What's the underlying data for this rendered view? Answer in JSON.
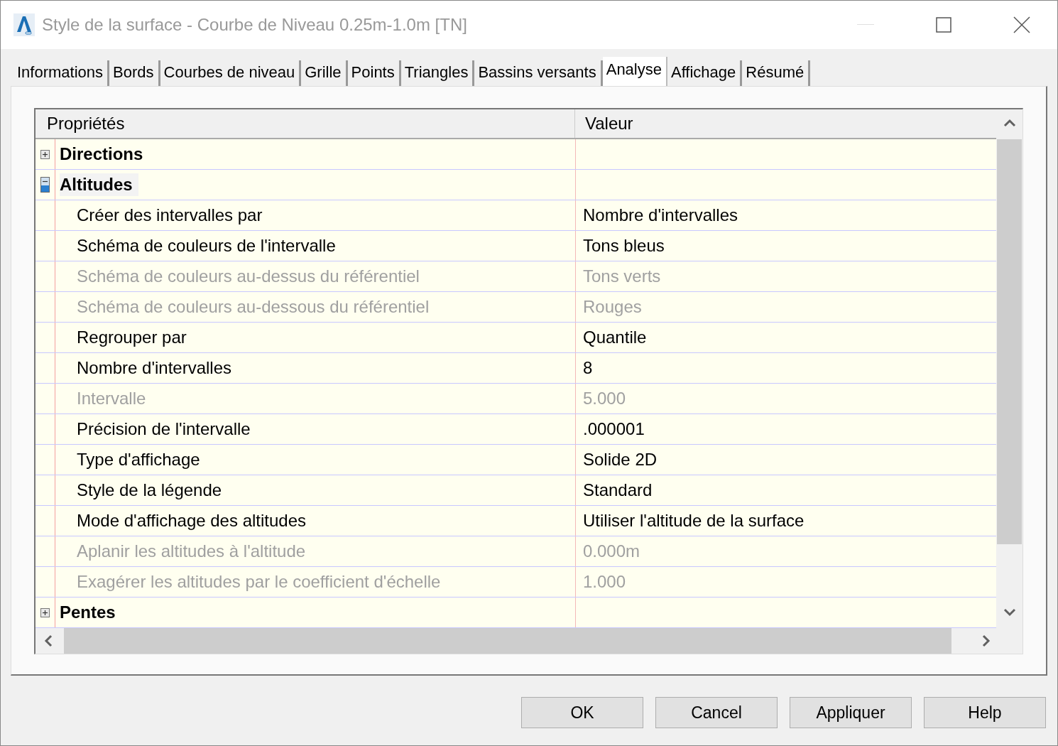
{
  "window": {
    "title": "Style de la surface - Courbe de Niveau 0.25m-1.0m [TN]"
  },
  "tabs": [
    {
      "label": "Informations",
      "selected": false
    },
    {
      "label": "Bords",
      "selected": false
    },
    {
      "label": "Courbes de niveau",
      "selected": false
    },
    {
      "label": "Grille",
      "selected": false
    },
    {
      "label": "Points",
      "selected": false
    },
    {
      "label": "Triangles",
      "selected": false
    },
    {
      "label": "Bassins versants",
      "selected": false
    },
    {
      "label": "Analyse",
      "selected": true
    },
    {
      "label": "Affichage",
      "selected": false
    },
    {
      "label": "Résumé",
      "selected": false
    }
  ],
  "grid": {
    "columns": [
      "Propriétés",
      "Valeur"
    ],
    "categories": [
      {
        "name": "Directions",
        "expanded": false,
        "selected": false
      },
      {
        "name": "Altitudes",
        "expanded": true,
        "selected": true,
        "children": [
          {
            "name": "Créer des intervalles par",
            "value": "Nombre d'intervalles",
            "disabled": false
          },
          {
            "name": "Schéma de couleurs de l'intervalle",
            "value": "Tons bleus",
            "disabled": false
          },
          {
            "name": "Schéma de couleurs au-dessus du référentiel",
            "value": "Tons verts",
            "disabled": true
          },
          {
            "name": "Schéma de couleurs au-dessous du référentiel",
            "value": "Rouges",
            "disabled": true
          },
          {
            "name": "Regrouper par",
            "value": "Quantile",
            "disabled": false
          },
          {
            "name": "Nombre d'intervalles",
            "value": "8",
            "disabled": false
          },
          {
            "name": "Intervalle",
            "value": "5.000",
            "disabled": true
          },
          {
            "name": "Précision de l'intervalle",
            "value": ".000001",
            "disabled": false
          },
          {
            "name": "Type d'affichage",
            "value": "Solide 2D",
            "disabled": false
          },
          {
            "name": "Style de la légende",
            "value": "Standard",
            "disabled": false
          },
          {
            "name": "Mode d'affichage des altitudes",
            "value": "Utiliser l'altitude de la surface",
            "disabled": false
          },
          {
            "name": "Aplanir les altitudes à l'altitude",
            "value": "0.000m",
            "disabled": true
          },
          {
            "name": "Exagérer les altitudes par le coefficient d'échelle",
            "value": "1.000",
            "disabled": true
          }
        ]
      },
      {
        "name": "Pentes",
        "expanded": false,
        "selected": false
      }
    ]
  },
  "buttons": [
    "OK",
    "Cancel",
    "Appliquer",
    "Help"
  ]
}
